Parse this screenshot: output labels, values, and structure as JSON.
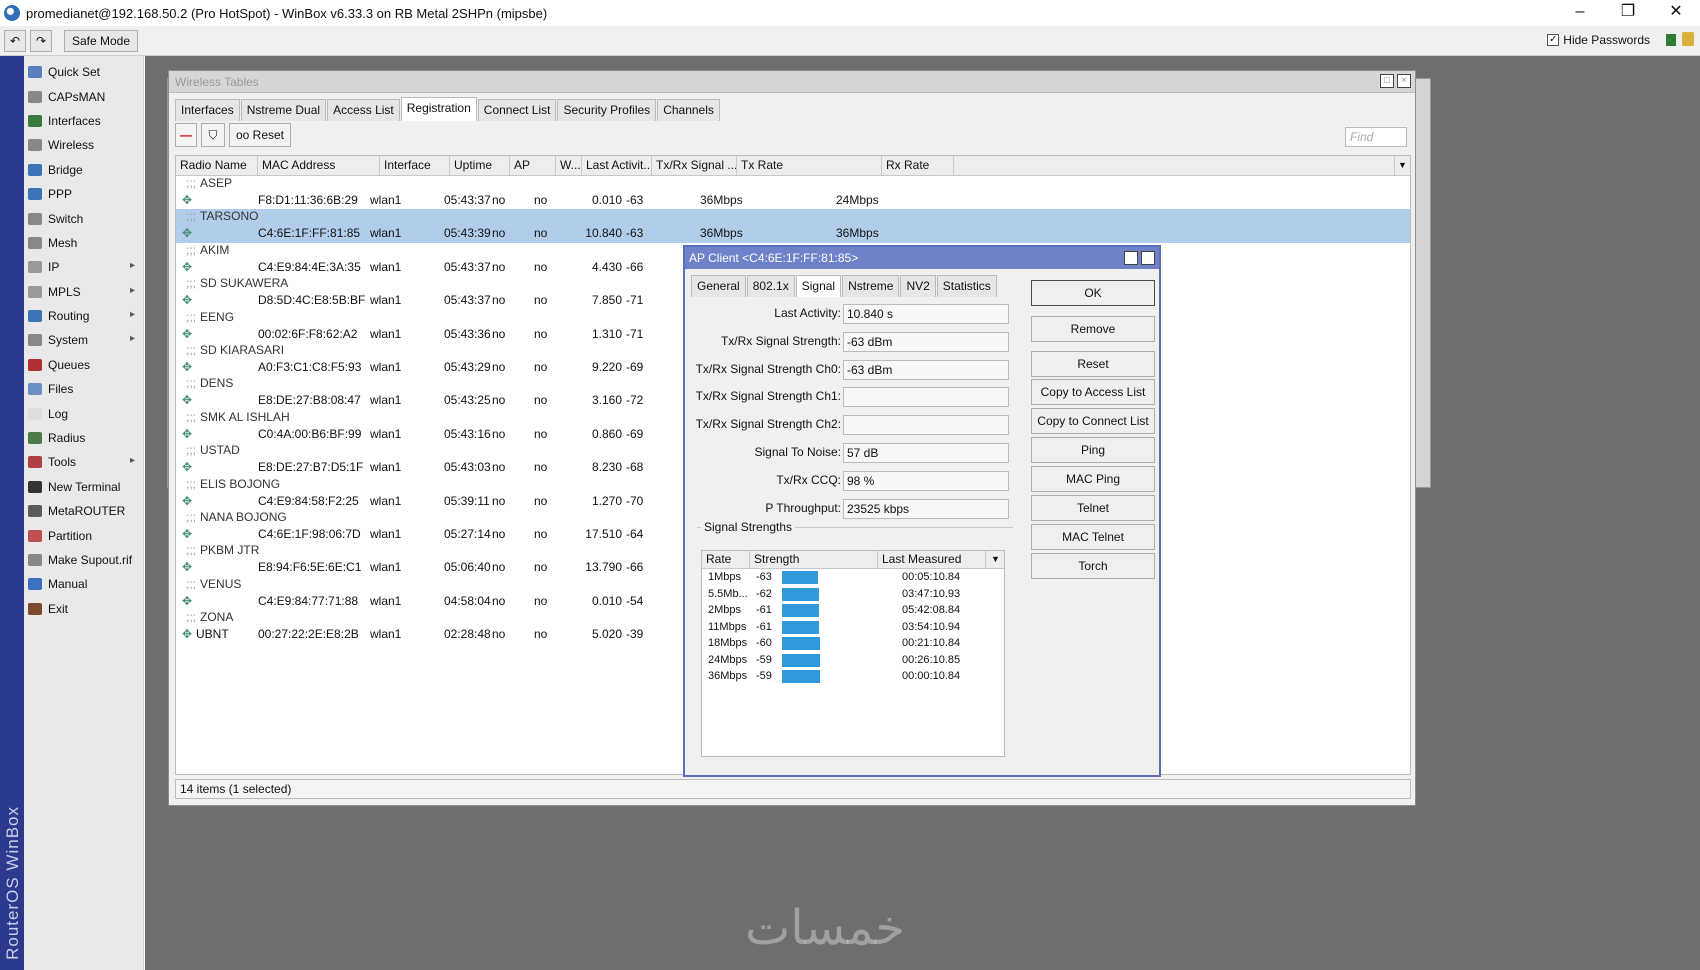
{
  "window": {
    "title": "promedianet@192.168.50.2 (Pro HotSpot) - WinBox v6.33.3 on RB Metal 2SHPn (mipsbe)",
    "controls": [
      "–",
      "❐",
      "✕"
    ]
  },
  "toolbar": {
    "undo": "↶",
    "redo": "↷",
    "safe_mode": "Safe Mode",
    "hide_passwords": "Hide Passwords",
    "hide_passwords_checked": "✓"
  },
  "brand": "RouterOS WinBox",
  "sidebar": {
    "items": [
      {
        "label": "Quick Set",
        "icon": "quick-set-icon",
        "color": "#5a7fbf",
        "sub": false
      },
      {
        "label": "CAPsMAN",
        "icon": "capsman-icon",
        "color": "#888888",
        "sub": false
      },
      {
        "label": "Interfaces",
        "icon": "interfaces-icon",
        "color": "#3a7a3a",
        "sub": false
      },
      {
        "label": "Wireless",
        "icon": "wireless-icon",
        "color": "#888888",
        "sub": false
      },
      {
        "label": "Bridge",
        "icon": "bridge-icon",
        "color": "#3b73b9",
        "sub": false
      },
      {
        "label": "PPP",
        "icon": "ppp-icon",
        "color": "#3b73b9",
        "sub": false
      },
      {
        "label": "Switch",
        "icon": "switch-icon",
        "color": "#888888",
        "sub": false
      },
      {
        "label": "Mesh",
        "icon": "mesh-icon",
        "color": "#888888",
        "sub": false
      },
      {
        "label": "IP",
        "icon": "ip-icon",
        "color": "#999999",
        "sub": true
      },
      {
        "label": "MPLS",
        "icon": "mpls-icon",
        "color": "#999999",
        "sub": true
      },
      {
        "label": "Routing",
        "icon": "routing-icon",
        "color": "#3b73b9",
        "sub": true
      },
      {
        "label": "System",
        "icon": "system-icon",
        "color": "#888888",
        "sub": true
      },
      {
        "label": "Queues",
        "icon": "queues-icon",
        "color": "#b03030",
        "sub": false
      },
      {
        "label": "Files",
        "icon": "files-icon",
        "color": "#6a8fc6",
        "sub": false
      },
      {
        "label": "Log",
        "icon": "log-icon",
        "color": "#dddddd",
        "sub": false
      },
      {
        "label": "Radius",
        "icon": "radius-icon",
        "color": "#4a7a4a",
        "sub": false
      },
      {
        "label": "Tools",
        "icon": "tools-icon",
        "color": "#b04040",
        "sub": true
      },
      {
        "label": "New Terminal",
        "icon": "terminal-icon",
        "color": "#333333",
        "sub": false
      },
      {
        "label": "MetaROUTER",
        "icon": "metarouter-icon",
        "color": "#5a5a5a",
        "sub": false
      },
      {
        "label": "Partition",
        "icon": "partition-icon",
        "color": "#c05050",
        "sub": false
      },
      {
        "label": "Make Supout.rif",
        "icon": "supout-icon",
        "color": "#888888",
        "sub": false
      },
      {
        "label": "Manual",
        "icon": "manual-icon",
        "color": "#3b6fc1",
        "sub": false
      },
      {
        "label": "Exit",
        "icon": "exit-icon",
        "color": "#7a4a2a",
        "sub": false
      }
    ]
  },
  "wireless_tables": {
    "title": "Wireless Tables",
    "tabs": [
      "Interfaces",
      "Nstreme Dual",
      "Access List",
      "Registration",
      "Connect List",
      "Security Profiles",
      "Channels"
    ],
    "active_tab": "Registration",
    "reset_label": "Reset",
    "find_placeholder": "Find",
    "columns": [
      "Radio Name",
      "MAC Address",
      "Interface",
      "Uptime",
      "AP",
      "W...",
      "Last Activit...",
      "Tx/Rx Signal ...",
      "Tx Rate",
      "Rx Rate"
    ],
    "rows": [
      {
        "name": "ASEP",
        "mac": "F8:D1:11:36:6B:29",
        "iface": "wlan1",
        "uptime": "05:43:37",
        "ap": "no",
        "w": "no",
        "last": "0.010",
        "sig": "-63",
        "tx": "36Mbps",
        "rx": "24Mbps",
        "selected": false
      },
      {
        "name": "TARSONO",
        "mac": "C4:6E:1F:FF:81:85",
        "iface": "wlan1",
        "uptime": "05:43:39",
        "ap": "no",
        "w": "no",
        "last": "10.840",
        "sig": "-63",
        "tx": "36Mbps",
        "rx": "36Mbps",
        "selected": true
      },
      {
        "name": "AKIM",
        "mac": "C4:E9:84:4E:3A:35",
        "iface": "wlan1",
        "uptime": "05:43:37",
        "ap": "no",
        "w": "no",
        "last": "4.430",
        "sig": "-66",
        "tx": "",
        "rx": "",
        "selected": false
      },
      {
        "name": "SD SUKAWERA",
        "mac": "D8:5D:4C:E8:5B:BF",
        "iface": "wlan1",
        "uptime": "05:43:37",
        "ap": "no",
        "w": "no",
        "last": "7.850",
        "sig": "-71",
        "tx": "",
        "rx": "",
        "selected": false
      },
      {
        "name": "EENG",
        "mac": "00:02:6F:F8:62:A2",
        "iface": "wlan1",
        "uptime": "05:43:36",
        "ap": "no",
        "w": "no",
        "last": "1.310",
        "sig": "-71",
        "tx": "",
        "rx": "",
        "selected": false
      },
      {
        "name": "SD KIARASARI",
        "mac": "A0:F3:C1:C8:F5:93",
        "iface": "wlan1",
        "uptime": "05:43:29",
        "ap": "no",
        "w": "no",
        "last": "9.220",
        "sig": "-69",
        "tx": "",
        "rx": "",
        "selected": false
      },
      {
        "name": "DENS",
        "mac": "E8:DE:27:B8:08:47",
        "iface": "wlan1",
        "uptime": "05:43:25",
        "ap": "no",
        "w": "no",
        "last": "3.160",
        "sig": "-72",
        "tx": "",
        "rx": "",
        "selected": false
      },
      {
        "name": "SMK AL ISHLAH",
        "mac": "C0:4A:00:B6:BF:99",
        "iface": "wlan1",
        "uptime": "05:43:16",
        "ap": "no",
        "w": "no",
        "last": "0.860",
        "sig": "-69",
        "tx": "",
        "rx": "",
        "selected": false
      },
      {
        "name": "USTAD",
        "mac": "E8:DE:27:B7:D5:1F",
        "iface": "wlan1",
        "uptime": "05:43:03",
        "ap": "no",
        "w": "no",
        "last": "8.230",
        "sig": "-68",
        "tx": "",
        "rx": "",
        "selected": false
      },
      {
        "name": "ELIS BOJONG",
        "mac": "C4:E9:84:58:F2:25",
        "iface": "wlan1",
        "uptime": "05:39:11",
        "ap": "no",
        "w": "no",
        "last": "1.270",
        "sig": "-70",
        "tx": "",
        "rx": "",
        "selected": false
      },
      {
        "name": "NANA BOJONG",
        "mac": "C4:6E:1F:98:06:7D",
        "iface": "wlan1",
        "uptime": "05:27:14",
        "ap": "no",
        "w": "no",
        "last": "17.510",
        "sig": "-64",
        "tx": "",
        "rx": "",
        "selected": false
      },
      {
        "name": "PKBM JTR",
        "mac": "E8:94:F6:5E:6E:C1",
        "iface": "wlan1",
        "uptime": "05:06:40",
        "ap": "no",
        "w": "no",
        "last": "13.790",
        "sig": "-66",
        "tx": "",
        "rx": "",
        "selected": false
      },
      {
        "name": "VENUS",
        "mac": "C4:E9:84:77:71:88",
        "iface": "wlan1",
        "uptime": "04:58:04",
        "ap": "no",
        "w": "no",
        "last": "0.010",
        "sig": "-54",
        "tx": "",
        "rx": "",
        "selected": false
      },
      {
        "name": "ZONA",
        "mac": "00:27:22:2E:E8:2B",
        "iface": "wlan1",
        "uptime": "02:28:48",
        "ap": "no",
        "w": "no",
        "last": "5.020",
        "sig": "-39",
        "tx": "",
        "rx": "",
        "selected": false,
        "prefix": "UBNT"
      }
    ],
    "status": "14 items (1 selected)"
  },
  "ap_client": {
    "title": "AP Client <C4:6E:1F:FF:81:85>",
    "tabs": [
      "General",
      "802.1x",
      "Signal",
      "Nstreme",
      "NV2",
      "Statistics"
    ],
    "active_tab": "Signal",
    "fields": [
      {
        "label": "Last Activity:",
        "value": "10.840 s"
      },
      {
        "label": "Tx/Rx Signal Strength:",
        "value": "-63 dBm"
      },
      {
        "label": "Tx/Rx Signal Strength Ch0:",
        "value": "-63 dBm"
      },
      {
        "label": "Tx/Rx Signal Strength Ch1:",
        "value": ""
      },
      {
        "label": "Tx/Rx Signal Strength Ch2:",
        "value": ""
      },
      {
        "label": "Signal To Noise:",
        "value": "57 dB"
      },
      {
        "label": "Tx/Rx CCQ:",
        "value": "98 %"
      },
      {
        "label": "P Throughput:",
        "value": "23525 kbps"
      }
    ],
    "group_label": "Signal Strengths",
    "strength_columns": [
      "Rate",
      "Strength",
      "Last Measured"
    ],
    "strengths": [
      {
        "rate": "1Mbps",
        "strength": "-63",
        "measured": "00:05:10.84",
        "level": 0.95
      },
      {
        "rate": "5.5Mb...",
        "strength": "-62",
        "measured": "03:47:10.93",
        "level": 0.97
      },
      {
        "rate": "2Mbps",
        "strength": "-61",
        "measured": "05:42:08.84",
        "level": 0.98
      },
      {
        "rate": "11Mbps",
        "strength": "-61",
        "measured": "03:54:10.94",
        "level": 0.98
      },
      {
        "rate": "18Mbps",
        "strength": "-60",
        "measured": "00:21:10.84",
        "level": 1.0
      },
      {
        "rate": "24Mbps",
        "strength": "-59",
        "measured": "00:26:10.85",
        "level": 1.0
      },
      {
        "rate": "36Mbps",
        "strength": "-59",
        "measured": "00:00:10.84",
        "level": 1.0
      }
    ],
    "buttons": [
      "OK",
      "Remove",
      "Reset",
      "Copy to Access List",
      "Copy to Connect List",
      "Ping",
      "MAC Ping",
      "Telnet",
      "MAC Telnet",
      "Torch"
    ]
  },
  "watermark": "خمسات"
}
